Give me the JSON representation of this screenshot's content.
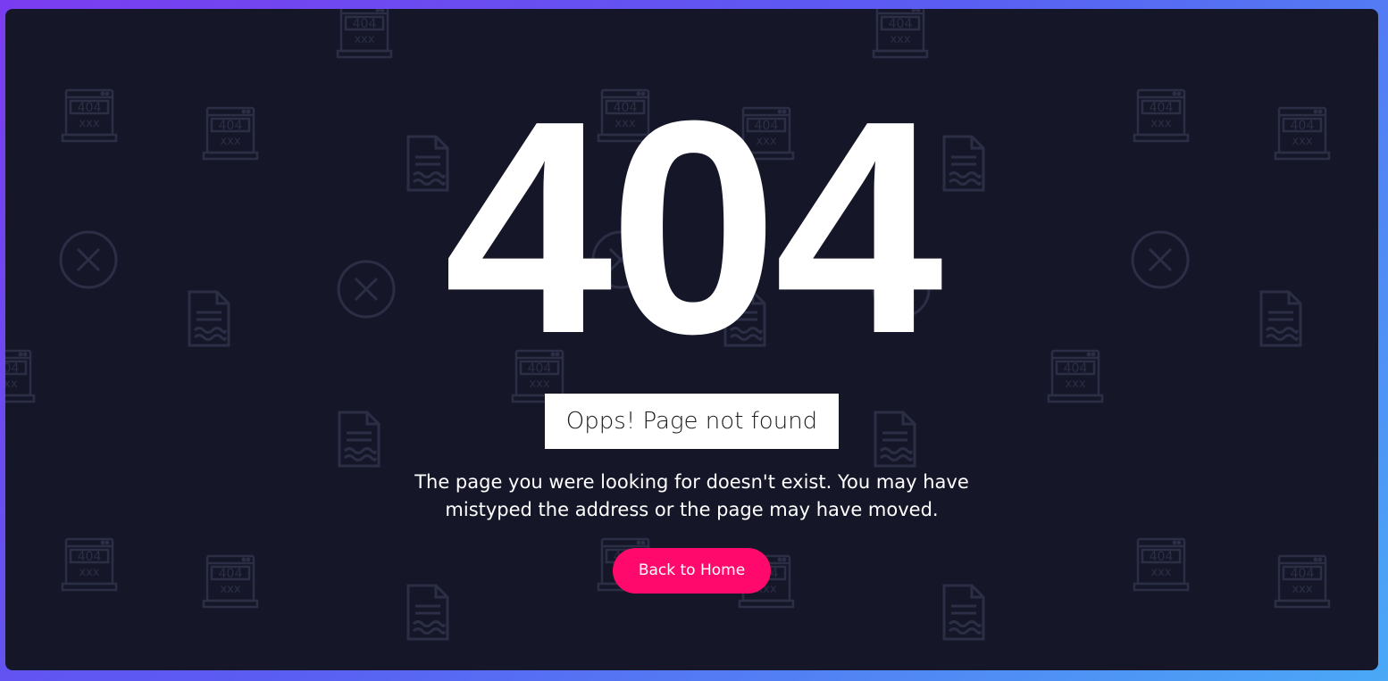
{
  "colors": {
    "background_gradient_start": "#7b3cf0",
    "background_gradient_end": "#4aa8f6",
    "panel_background": "#151729",
    "pattern_icon": "#2b2e45",
    "headline": "#ffffff",
    "button_background": "#ff0a6c",
    "button_text": "#ffffff"
  },
  "icons": {
    "pattern_x": "close-circle-icon",
    "pattern_doc": "document-icon",
    "pattern_monitor": "monitor-404-icon"
  },
  "error": {
    "code": "404",
    "title": "Opps! Page not found",
    "description_line1": "The page you were looking for doesn't exist. You may have",
    "description_line2": "mistyped the address or the page may have moved.",
    "button_label": "Back to Home",
    "monitor_label": "404",
    "monitor_sub": "xxx"
  }
}
